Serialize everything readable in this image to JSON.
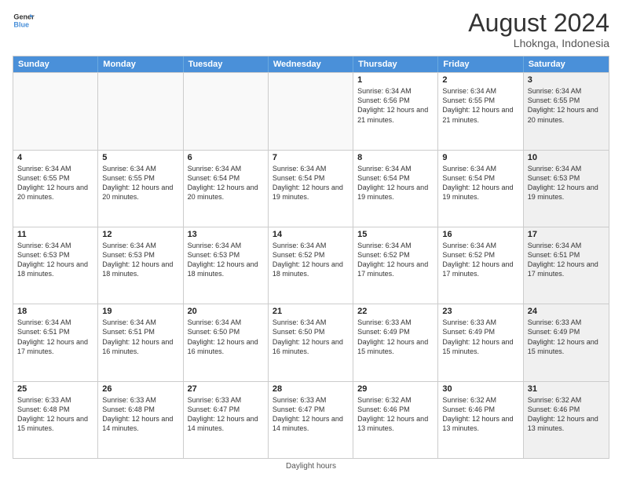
{
  "logo": {
    "line1": "General",
    "line2": "Blue"
  },
  "title": "August 2024",
  "location": "Lhoknga, Indonesia",
  "days_of_week": [
    "Sunday",
    "Monday",
    "Tuesday",
    "Wednesday",
    "Thursday",
    "Friday",
    "Saturday"
  ],
  "footer": "Daylight hours",
  "weeks": [
    [
      {
        "day": "",
        "empty": true
      },
      {
        "day": "",
        "empty": true
      },
      {
        "day": "",
        "empty": true
      },
      {
        "day": "",
        "empty": true
      },
      {
        "day": "1",
        "sunrise": "6:34 AM",
        "sunset": "6:56 PM",
        "daylight": "12 hours and 21 minutes."
      },
      {
        "day": "2",
        "sunrise": "6:34 AM",
        "sunset": "6:55 PM",
        "daylight": "12 hours and 21 minutes."
      },
      {
        "day": "3",
        "sunrise": "6:34 AM",
        "sunset": "6:55 PM",
        "daylight": "12 hours and 20 minutes.",
        "shaded": true
      }
    ],
    [
      {
        "day": "4",
        "sunrise": "6:34 AM",
        "sunset": "6:55 PM",
        "daylight": "12 hours and 20 minutes."
      },
      {
        "day": "5",
        "sunrise": "6:34 AM",
        "sunset": "6:55 PM",
        "daylight": "12 hours and 20 minutes."
      },
      {
        "day": "6",
        "sunrise": "6:34 AM",
        "sunset": "6:54 PM",
        "daylight": "12 hours and 20 minutes."
      },
      {
        "day": "7",
        "sunrise": "6:34 AM",
        "sunset": "6:54 PM",
        "daylight": "12 hours and 19 minutes."
      },
      {
        "day": "8",
        "sunrise": "6:34 AM",
        "sunset": "6:54 PM",
        "daylight": "12 hours and 19 minutes."
      },
      {
        "day": "9",
        "sunrise": "6:34 AM",
        "sunset": "6:54 PM",
        "daylight": "12 hours and 19 minutes."
      },
      {
        "day": "10",
        "sunrise": "6:34 AM",
        "sunset": "6:53 PM",
        "daylight": "12 hours and 19 minutes.",
        "shaded": true
      }
    ],
    [
      {
        "day": "11",
        "sunrise": "6:34 AM",
        "sunset": "6:53 PM",
        "daylight": "12 hours and 18 minutes."
      },
      {
        "day": "12",
        "sunrise": "6:34 AM",
        "sunset": "6:53 PM",
        "daylight": "12 hours and 18 minutes."
      },
      {
        "day": "13",
        "sunrise": "6:34 AM",
        "sunset": "6:53 PM",
        "daylight": "12 hours and 18 minutes."
      },
      {
        "day": "14",
        "sunrise": "6:34 AM",
        "sunset": "6:52 PM",
        "daylight": "12 hours and 18 minutes."
      },
      {
        "day": "15",
        "sunrise": "6:34 AM",
        "sunset": "6:52 PM",
        "daylight": "12 hours and 17 minutes."
      },
      {
        "day": "16",
        "sunrise": "6:34 AM",
        "sunset": "6:52 PM",
        "daylight": "12 hours and 17 minutes."
      },
      {
        "day": "17",
        "sunrise": "6:34 AM",
        "sunset": "6:51 PM",
        "daylight": "12 hours and 17 minutes.",
        "shaded": true
      }
    ],
    [
      {
        "day": "18",
        "sunrise": "6:34 AM",
        "sunset": "6:51 PM",
        "daylight": "12 hours and 17 minutes."
      },
      {
        "day": "19",
        "sunrise": "6:34 AM",
        "sunset": "6:51 PM",
        "daylight": "12 hours and 16 minutes."
      },
      {
        "day": "20",
        "sunrise": "6:34 AM",
        "sunset": "6:50 PM",
        "daylight": "12 hours and 16 minutes."
      },
      {
        "day": "21",
        "sunrise": "6:34 AM",
        "sunset": "6:50 PM",
        "daylight": "12 hours and 16 minutes."
      },
      {
        "day": "22",
        "sunrise": "6:33 AM",
        "sunset": "6:49 PM",
        "daylight": "12 hours and 15 minutes."
      },
      {
        "day": "23",
        "sunrise": "6:33 AM",
        "sunset": "6:49 PM",
        "daylight": "12 hours and 15 minutes."
      },
      {
        "day": "24",
        "sunrise": "6:33 AM",
        "sunset": "6:49 PM",
        "daylight": "12 hours and 15 minutes.",
        "shaded": true
      }
    ],
    [
      {
        "day": "25",
        "sunrise": "6:33 AM",
        "sunset": "6:48 PM",
        "daylight": "12 hours and 15 minutes."
      },
      {
        "day": "26",
        "sunrise": "6:33 AM",
        "sunset": "6:48 PM",
        "daylight": "12 hours and 14 minutes."
      },
      {
        "day": "27",
        "sunrise": "6:33 AM",
        "sunset": "6:47 PM",
        "daylight": "12 hours and 14 minutes."
      },
      {
        "day": "28",
        "sunrise": "6:33 AM",
        "sunset": "6:47 PM",
        "daylight": "12 hours and 14 minutes."
      },
      {
        "day": "29",
        "sunrise": "6:32 AM",
        "sunset": "6:46 PM",
        "daylight": "12 hours and 13 minutes."
      },
      {
        "day": "30",
        "sunrise": "6:32 AM",
        "sunset": "6:46 PM",
        "daylight": "12 hours and 13 minutes."
      },
      {
        "day": "31",
        "sunrise": "6:32 AM",
        "sunset": "6:46 PM",
        "daylight": "12 hours and 13 minutes.",
        "shaded": true
      }
    ]
  ]
}
